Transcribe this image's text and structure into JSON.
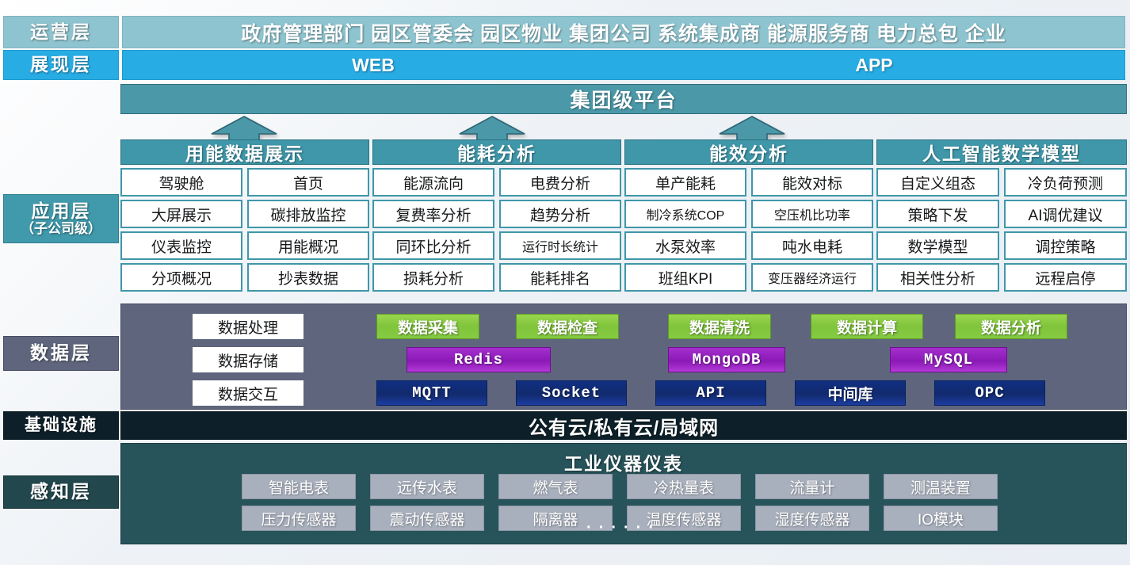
{
  "layers": {
    "operation": {
      "label": "运营层",
      "roles": "政府管理部门 园区管委会 园区物业 集团公司 系统集成商 能源服务商 电力总包 企业"
    },
    "presentation": {
      "label": "展现层",
      "web": "WEB",
      "app": "APP"
    },
    "platform": {
      "title": "集团级平台"
    },
    "application": {
      "label_main": "应用层",
      "label_sub": "（子公司级）",
      "groups": [
        {
          "title": "用能数据展示",
          "col1": [
            "驾驶舱",
            "大屏展示",
            "仪表监控",
            "分项概况"
          ],
          "col2": [
            "首页",
            "碳排放监控",
            "用能概况",
            "抄表数据"
          ]
        },
        {
          "title": "能耗分析",
          "col1": [
            "能源流向",
            "复费率分析",
            "同环比分析",
            "损耗分析"
          ],
          "col2": [
            "电费分析",
            "趋势分析",
            "运行时长统计",
            "能耗排名"
          ]
        },
        {
          "title": "能效分析",
          "col1": [
            "单产能耗",
            "制冷系统COP",
            "水泵效率",
            "班组KPI"
          ],
          "col2": [
            "能效对标",
            "空压机比功率",
            "吨水电耗",
            "变压器经济运行"
          ]
        },
        {
          "title": "人工智能数学模型",
          "col1": [
            "自定义组态",
            "策略下发",
            "数学模型",
            "相关性分析"
          ],
          "col2": [
            "冷负荷预测",
            "AI调优建议",
            "调控策略",
            "远程启停"
          ]
        }
      ]
    },
    "data": {
      "label": "数据层",
      "categories": [
        "数据处理",
        "数据存储",
        "数据交互"
      ],
      "green_items": [
        "数据采集",
        "数据检查",
        "数据清洗",
        "数据计算",
        "数据分析"
      ],
      "purple_items": [
        "Redis",
        "MongoDB",
        "MySQL"
      ],
      "blue_items": [
        "MQTT",
        "Socket",
        "API",
        "中间库",
        "OPC"
      ]
    },
    "infrastructure": {
      "label": "基础设施",
      "text": "公有云/私有云/局域网"
    },
    "sensing": {
      "label": "感知层",
      "title": "工业仪器仪表",
      "row1": [
        "智能电表",
        "远传水表",
        "燃气表",
        "冷热量表",
        "流量计",
        "测温装置"
      ],
      "row2": [
        "压力传感器",
        "震动传感器",
        "隔离器",
        "温度传感器",
        "湿度传感器",
        "IO模块"
      ],
      "dots": "······"
    }
  },
  "colors": {
    "operation": "#8ec4cf",
    "presentation": "#27ace4",
    "platform": "#4b98a8",
    "application": "#3f97a9",
    "data": "#5e657c",
    "green": "#7fc43a",
    "purple": "#8a19b5",
    "blue": "#122a6e",
    "infrastructure": "#0d2029",
    "sensing": "#27535a",
    "sensor_chip": "#a9b0bd"
  }
}
